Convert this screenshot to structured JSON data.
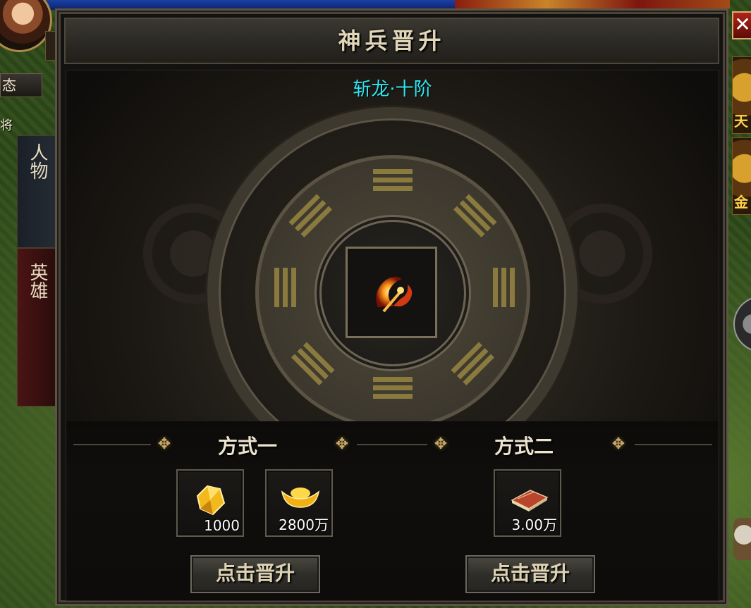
{
  "panel": {
    "title": "神兵晋升",
    "weapon_name": "斩龙·十阶",
    "close_label": "✕"
  },
  "side": {
    "status_label": "态",
    "general_label": "将",
    "tab_person": "人物",
    "tab_hero": "英雄",
    "right_icon_1": "天",
    "right_icon_2": "金"
  },
  "methods": [
    {
      "label": "方式一",
      "items": [
        {
          "icon": "yellow-gem-icon",
          "quantity": "1000"
        },
        {
          "icon": "gold-ingot-icon",
          "quantity": "2800万"
        }
      ],
      "button": "点击晋升"
    },
    {
      "label": "方式二",
      "items": [
        {
          "icon": "red-book-icon",
          "quantity": "3.00万"
        }
      ],
      "button": "点击晋升"
    }
  ],
  "colors": {
    "subtitle": "#2fe6f2",
    "accent_gold": "#c7a86a"
  }
}
